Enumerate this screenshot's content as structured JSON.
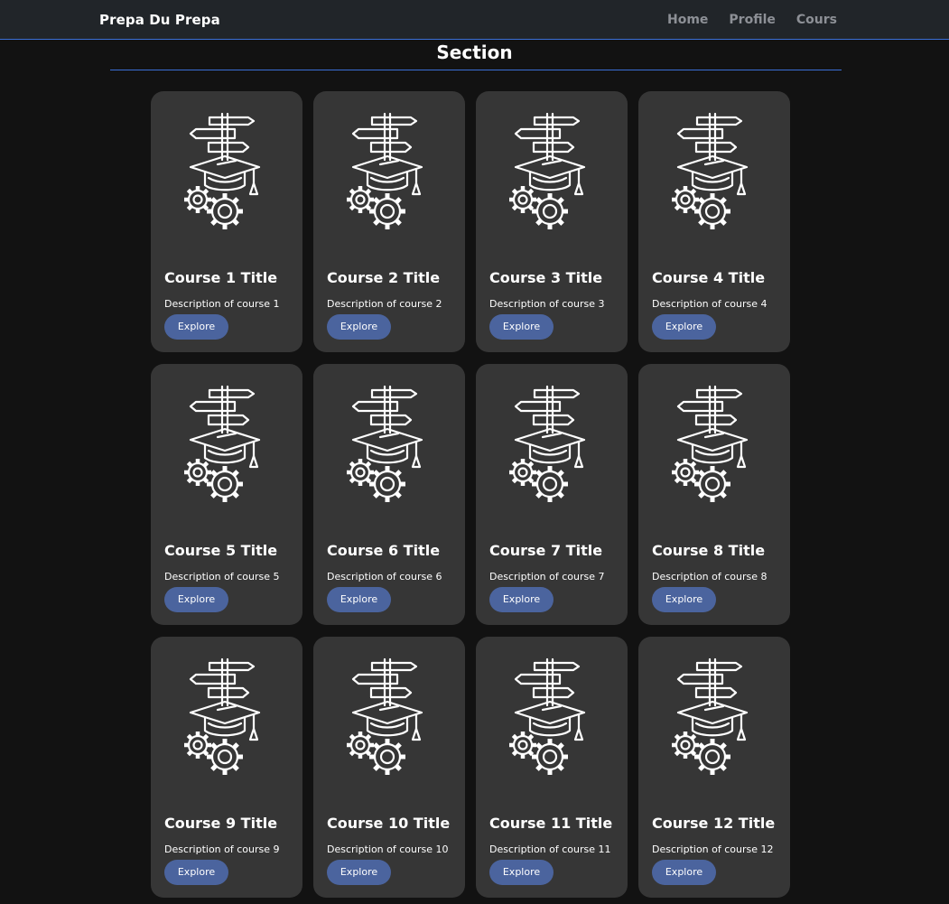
{
  "navbar": {
    "brand": "Prepa Du Prepa",
    "links": [
      "Home",
      "Profile",
      "Cours"
    ]
  },
  "section": {
    "title": "Section"
  },
  "courses": [
    {
      "title": "Course 1 Title",
      "description": "Description of course 1",
      "button": "Explore"
    },
    {
      "title": "Course 2 Title",
      "description": "Description of course 2",
      "button": "Explore"
    },
    {
      "title": "Course 3 Title",
      "description": "Description of course 3",
      "button": "Explore"
    },
    {
      "title": "Course 4 Title",
      "description": "Description of course 4",
      "button": "Explore"
    },
    {
      "title": "Course 5 Title",
      "description": "Description of course 5",
      "button": "Explore"
    },
    {
      "title": "Course 6 Title",
      "description": "Description of course 6",
      "button": "Explore"
    },
    {
      "title": "Course 7 Title",
      "description": "Description of course 7",
      "button": "Explore"
    },
    {
      "title": "Course 8 Title",
      "description": "Description of course 8",
      "button": "Explore"
    },
    {
      "title": "Course 9 Title",
      "description": "Description of course 9",
      "button": "Explore"
    },
    {
      "title": "Course 10 Title",
      "description": "Description of course 10",
      "button": "Explore"
    },
    {
      "title": "Course 11 Title",
      "description": "Description of course 11",
      "button": "Explore"
    },
    {
      "title": "Course 12 Title",
      "description": "Description of course 12",
      "button": "Explore"
    }
  ],
  "card_icon": "education-gears-signpost-icon",
  "colors": {
    "page_bg": "#121212",
    "navbar_bg": "#212529",
    "accent_line": "#3b6fd6",
    "card_bg": "#363636",
    "button_bg": "#4b649e",
    "nav_link": "#8d9096"
  }
}
